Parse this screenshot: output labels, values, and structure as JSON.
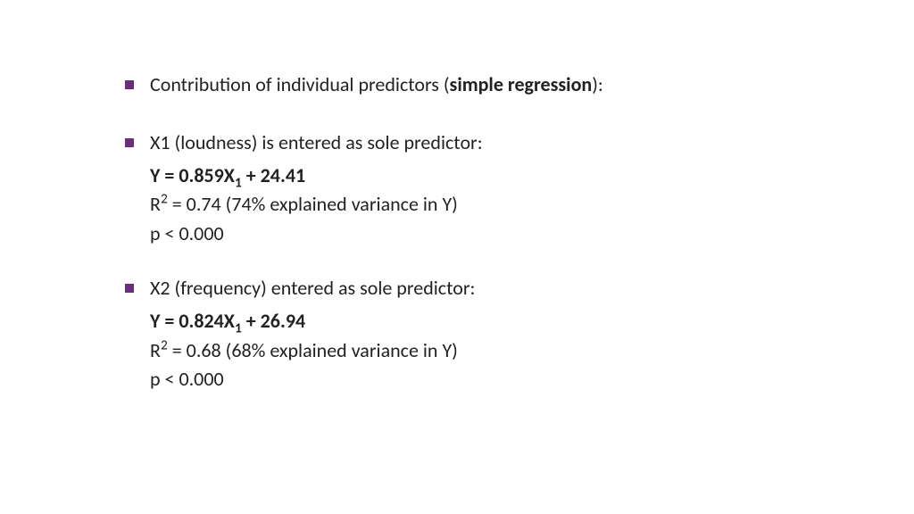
{
  "bullets": [
    {
      "prefix": "Contribution of individual predictors (",
      "bold": "simple regression",
      "suffix": "):"
    },
    {
      "text": "X1 (loudness) is entered as sole predictor:",
      "lines": [
        {
          "eq_pre": "Y = 0.859X",
          "eq_sub": "1",
          "eq_post": " + 24.41"
        },
        {
          "r2_pre": "R",
          "r2_sup": "2",
          "r2_post": " = 0.74 (74% explained variance in Y)"
        },
        {
          "plain": "p < 0.000"
        }
      ]
    },
    {
      "text": "X2 (frequency) entered as sole predictor:",
      "lines": [
        {
          "eq_pre": "Y = 0.824X",
          "eq_sub": "1",
          "eq_post": " + 26.94"
        },
        {
          "r2_pre": "R",
          "r2_sup": "2",
          "r2_post": " = 0.68 (68% explained variance in Y)"
        },
        {
          "plain": "p < 0.000"
        }
      ]
    }
  ]
}
